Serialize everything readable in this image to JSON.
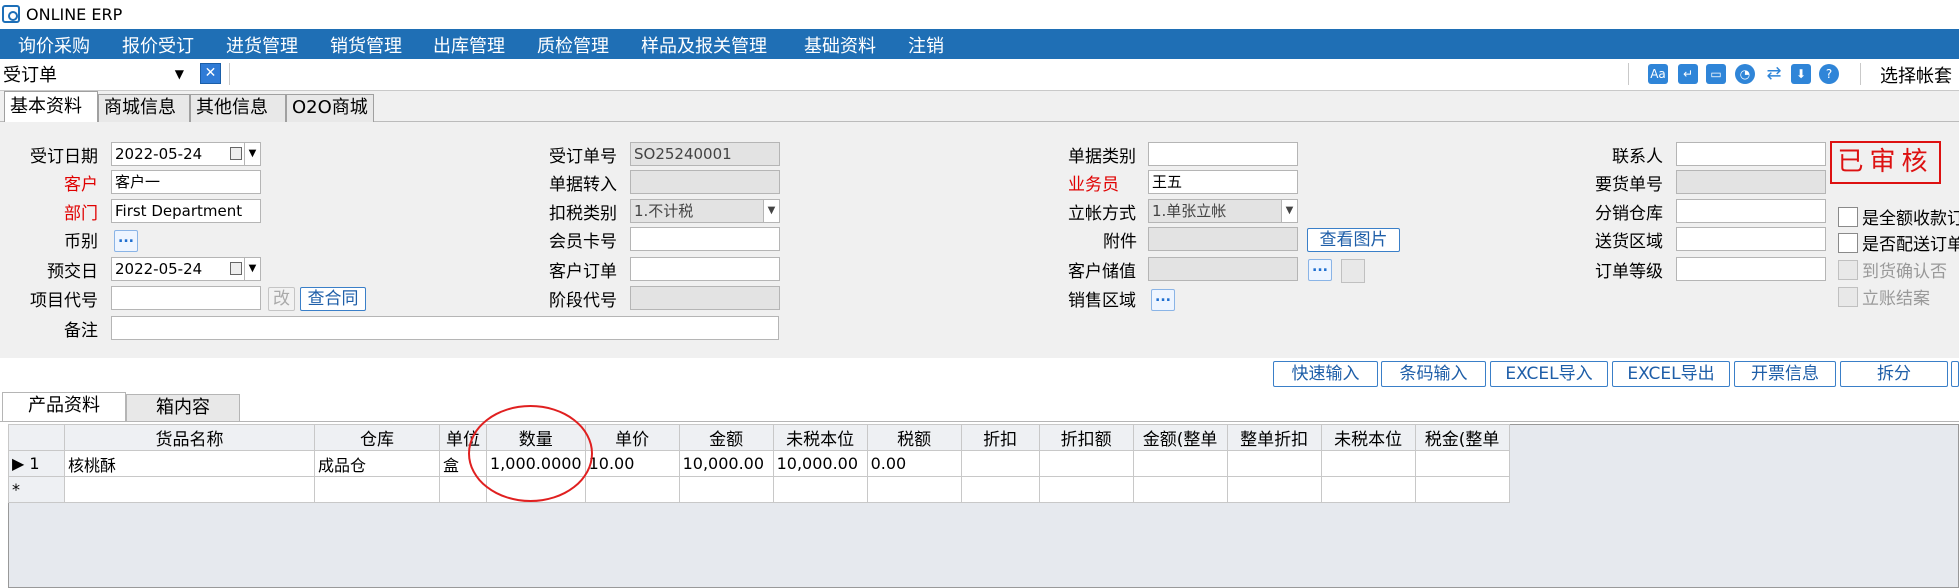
{
  "app": {
    "title": "ONLINE ERP"
  },
  "menu": [
    "询价采购",
    "报价受订",
    "进货管理",
    "销货管理",
    "出库管理",
    "质检管理",
    "样品及报关管理",
    "基础资料",
    "注销"
  ],
  "toolbar": {
    "doc_type": "受订单",
    "account_label": "选择帐套",
    "icons": [
      "aa-icon",
      "return-icon",
      "window-icon",
      "dashboard-icon",
      "refresh-icon",
      "download-icon",
      "help-icon"
    ]
  },
  "top_tabs": [
    "基本资料",
    "商城信息",
    "其他信息",
    "O2O商城"
  ],
  "form": {
    "order_date_label": "受订日期",
    "order_date": "2022-05-24",
    "customer_label": "客户",
    "customer": "客户一",
    "dept_label": "部门",
    "dept": "First Department",
    "currency_label": "币别",
    "delivery_date_label": "预交日",
    "delivery_date": "2022-05-24",
    "project_label": "项目代号",
    "change_btn": "改",
    "contract_btn": "查合同",
    "remark_label": "备注",
    "order_no_label": "受订单号",
    "order_no": "SO25240001",
    "transfer_label": "单据转入",
    "tax_type_label": "扣税类别",
    "tax_type": "1.不计税",
    "member_label": "会员卡号",
    "cust_order_label": "客户订单",
    "stage_label": "阶段代号",
    "bill_type_label": "单据类别",
    "salesman_label": "业务员",
    "salesman": "王五",
    "account_mode_label": "立帐方式",
    "account_mode": "1.单张立帐",
    "attach_label": "附件",
    "view_image_btn": "查看图片",
    "stored_value_label": "客户储值",
    "sales_area_label": "销售区域",
    "contact_label": "联系人",
    "req_no_label": "要货单号",
    "dist_wh_label": "分销仓库",
    "ship_area_label": "送货区域",
    "order_level_label": "订单等级",
    "stamp": "已审核",
    "chk_full_receipt": "是全额收款订",
    "chk_delivery": "是否配送订单",
    "chk_arrival": "到货确认否",
    "chk_settled": "立账结案"
  },
  "actions": [
    "快速输入",
    "条码输入",
    "EXCEL导入",
    "EXCEL导出",
    "开票信息",
    "拆分"
  ],
  "bottom_tabs": [
    "产品资料",
    "箱内容"
  ],
  "grid": {
    "columns": [
      "货品名称",
      "仓库",
      "单位",
      "数量",
      "单价",
      "金额",
      "未税本位",
      "税额",
      "折扣",
      "折扣额",
      "金额(整单",
      "整单折扣",
      "未税本位",
      "税金(整单"
    ],
    "rows": [
      {
        "no": "1",
        "cells": [
          "核桃酥",
          "成品仓",
          "盒",
          "1,000.0000",
          "10.00",
          "10,000.00",
          "10,000.00",
          "0.00",
          "",
          "",
          "",
          "",
          "",
          ""
        ]
      }
    ],
    "new_row_marker": "*"
  },
  "colors": {
    "menu_bg": "#1f6fb5",
    "required_label": "#e00000",
    "stamp": "#d11111",
    "highlight_circle": "#e02020"
  }
}
